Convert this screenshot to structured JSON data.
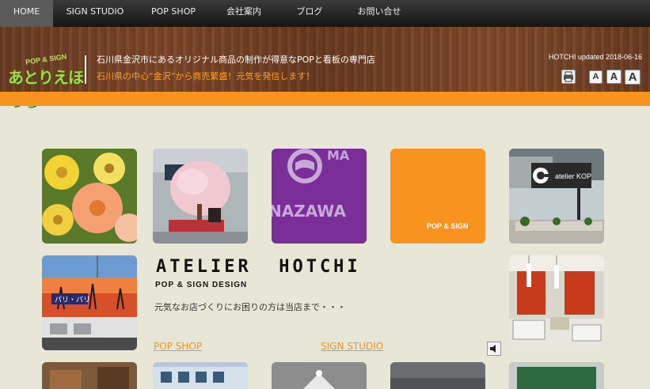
{
  "nav": {
    "items": [
      {
        "label": "HOME",
        "active": true
      },
      {
        "label": "SIGN STUDIO",
        "active": false
      },
      {
        "label": "POP SHOP",
        "active": false
      },
      {
        "label": "会社案内",
        "active": false
      },
      {
        "label": "ブログ",
        "active": false
      },
      {
        "label": "お問い合せ",
        "active": false
      }
    ]
  },
  "header": {
    "logo_small": "POP & SIGN",
    "logo_main": "あとりえほっち",
    "tagline": "石川県金沢市にあるオリジナル商品の制作が得意なPOPと看板の専門店",
    "subtag": "石川県の中心“金沢”から商売繁盛！元気を発信します！",
    "updated": "HOTCHI updated 2018-06-16",
    "font_sizes": [
      "A",
      "A",
      "A"
    ]
  },
  "tiles": {
    "pop_sign_caption": "POP & SIGN",
    "sign_caption": "atelier KOP",
    "purple_text_top": "MA",
    "purple_text_bottom": "NAZAWA",
    "shop_sign_text": "パリ・パリ"
  },
  "main": {
    "title": "ATELIER  HOTCHI",
    "subtitle": "POP & SIGN DESIGN",
    "lead": "元気なお店づくりにお困りの方は当店まで・・・",
    "link_pop_shop": "POP SHOP",
    "link_sign_studio": "SIGN STUDIO"
  },
  "colors": {
    "accent": "#f7931e",
    "nav_bg": "#1a1a1a",
    "page_bg": "#e8e6d6"
  }
}
